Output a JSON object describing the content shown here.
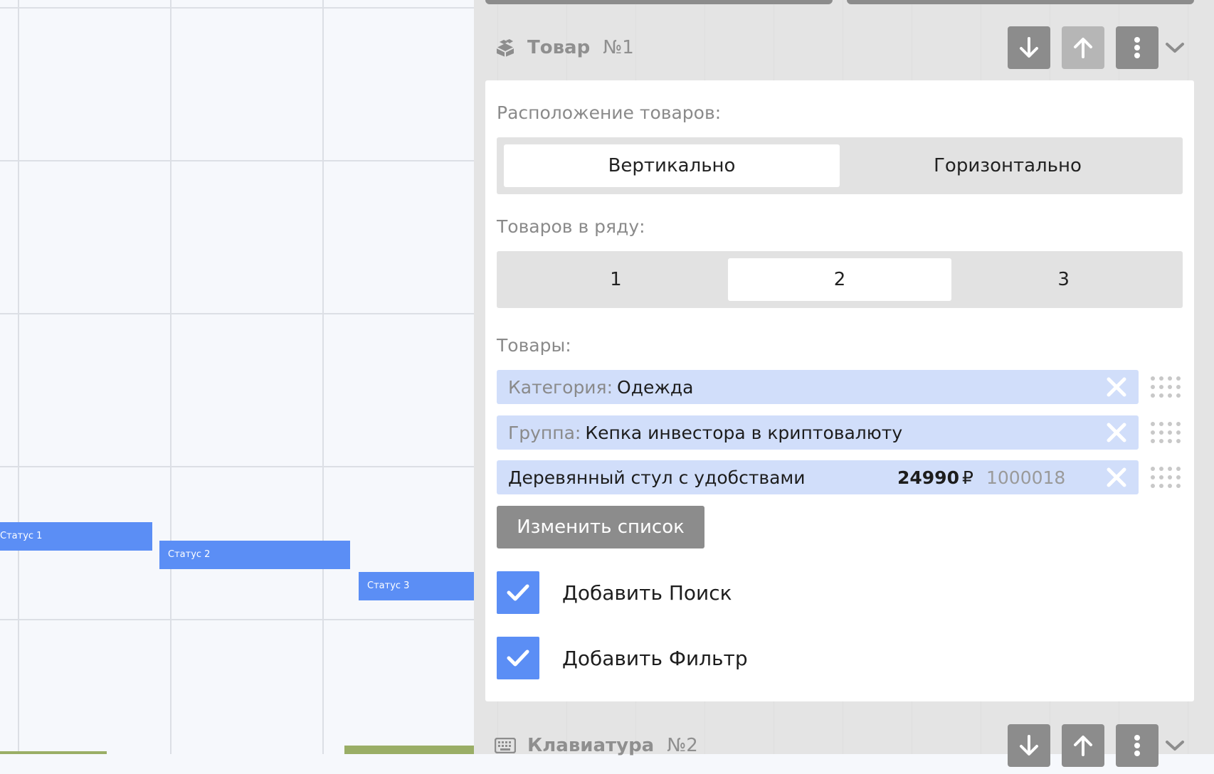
{
  "canvas": {
    "status_labels": [
      "Статус 1",
      "Статус 2",
      "Статус 3"
    ]
  },
  "section1": {
    "icon": "boxes-icon",
    "title": "Товар",
    "number": "№1",
    "layout": {
      "label": "Расположение товаров:",
      "options": [
        "Вертикально",
        "Горизонтально"
      ],
      "selected": "Вертикально"
    },
    "per_row": {
      "label": "Товаров в ряду:",
      "options": [
        "1",
        "2",
        "3"
      ],
      "selected": "2"
    },
    "products": {
      "label": "Товары:",
      "items": [
        {
          "prefix": "Категория:",
          "name": "Одежда"
        },
        {
          "prefix": "Группа:",
          "name": "Кепка инвестора в криптовалюту"
        },
        {
          "prefix": "",
          "name": "Деревянный стул с удобствами",
          "price": "24990",
          "currency": "₽",
          "code": "1000018"
        }
      ]
    },
    "change_list_button": "Изменить список",
    "checkboxes": [
      {
        "label": "Добавить Поиск",
        "checked": true
      },
      {
        "label": "Добавить Фильтр",
        "checked": true
      }
    ]
  },
  "section2": {
    "icon": "keyboard-icon",
    "title": "Клавиатура",
    "number": "№2"
  },
  "colors": {
    "accent": "#5b8ef5",
    "tag_bg": "#d1defa",
    "header_button": "#8c8c8c",
    "header_button_disabled": "#b6b6b6"
  }
}
